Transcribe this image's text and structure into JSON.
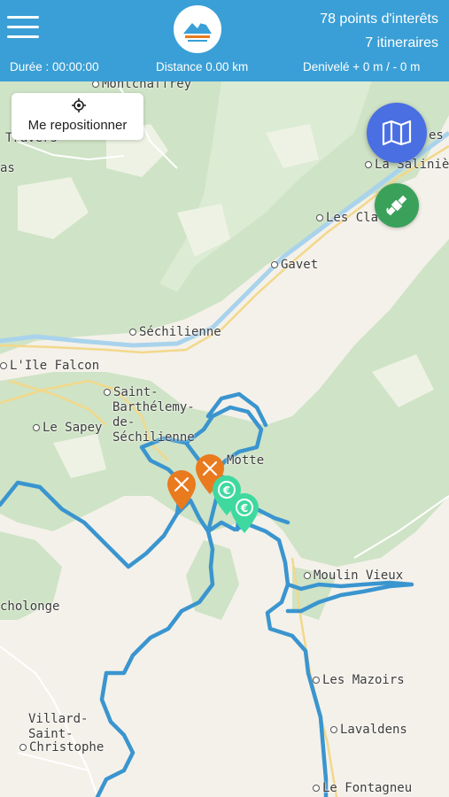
{
  "header": {
    "menu_icon": "hamburger-icon",
    "logo_icon": "brand-logo-icon",
    "poi_count": "78 points d'interêts",
    "itineraries_count": "7 itineraires",
    "duration": "Durée : 00:00:00",
    "distance": "Distance 0.00 km",
    "elevation": "Denivelé + 0 m / - 0 m"
  },
  "controls": {
    "reposition_label": "Me repositionner",
    "reposition_icon": "crosshair-icon",
    "map_layer_icon": "map-icon",
    "satellite_icon": "satellite-icon"
  },
  "map": {
    "places": [
      {
        "name": "Montchaffrey",
        "dot": true
      },
      {
        "name": "Travers",
        "dot": false
      },
      {
        "name": "as",
        "dot": false
      },
      {
        "name": "es C",
        "dot": false
      },
      {
        "name": "La Salinière",
        "dot": true
      },
      {
        "name": "Les Clava",
        "dot": true
      },
      {
        "name": "Gavet",
        "dot": true
      },
      {
        "name": "Séchilienne",
        "dot": true
      },
      {
        "name": "L'Ile Falcon",
        "dot": true
      },
      {
        "name": "Saint-",
        "dot": true
      },
      {
        "name": "Barthélemy-",
        "dot": false
      },
      {
        "name": "de-",
        "dot": false
      },
      {
        "name": "Séchilienne",
        "dot": false
      },
      {
        "name": "Le Sapey",
        "dot": true
      },
      {
        "name": "Motte",
        "dot": false
      },
      {
        "name": "Moulin Vieux",
        "dot": true
      },
      {
        "name": "cholonge",
        "dot": false
      },
      {
        "name": "Les Mazoirs",
        "dot": true
      },
      {
        "name": "Lavaldens",
        "dot": true
      },
      {
        "name": "Villard-",
        "dot": false
      },
      {
        "name": "Saint-",
        "dot": false
      },
      {
        "name": "Christophe",
        "dot": true
      },
      {
        "name": "Le Fontagneu",
        "dot": true
      }
    ],
    "colors": {
      "header": "#3a9fd6",
      "route": "#3a95cf",
      "forest": "#cfe3c6",
      "land": "#f4f1ea",
      "restaurant_pin": "#e97a1e",
      "money_pin": "#3fd9a0",
      "map_fab": "#4a6fe2",
      "satellite_fab": "#3aa15a"
    },
    "pins": [
      {
        "type": "restaurant",
        "icon": "fork-knife-icon"
      },
      {
        "type": "restaurant",
        "icon": "fork-knife-icon"
      },
      {
        "type": "money",
        "icon": "euro-icon"
      },
      {
        "type": "money",
        "icon": "euro-icon"
      }
    ]
  }
}
